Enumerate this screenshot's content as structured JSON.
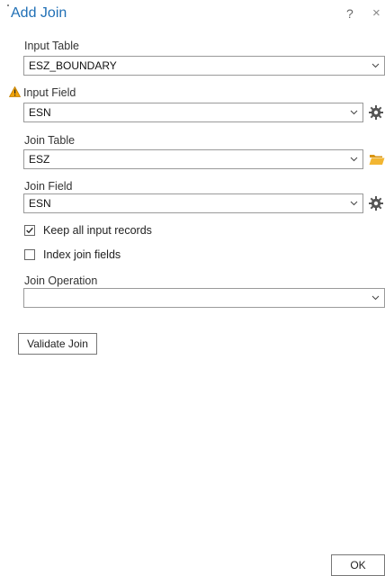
{
  "dialog": {
    "title": "Add Join",
    "help": "?",
    "close": "×"
  },
  "fields": {
    "input_table": {
      "label": "Input Table",
      "value": "ESZ_BOUNDARY"
    },
    "input_field": {
      "label": "Input Field",
      "value": "ESN",
      "warning": true
    },
    "join_table": {
      "label": "Join Table",
      "value": "ESZ"
    },
    "join_field": {
      "label": "Join Field",
      "value": "ESN"
    },
    "join_operation": {
      "label": "Join Operation",
      "value": ""
    }
  },
  "options": {
    "keep_all_records": {
      "label": "Keep all input records",
      "checked": true
    },
    "index_join_fields": {
      "label": "Index join fields",
      "checked": false
    }
  },
  "buttons": {
    "validate": "Validate Join",
    "ok": "OK"
  },
  "colors": {
    "title": "#1f6fb5",
    "warning": "#f0a30a",
    "folder": "#e8a317"
  },
  "icons": {
    "warning": "warning-triangle-icon",
    "gear": "gear-icon",
    "folder": "folder-open-icon",
    "chevron": "chevron-down-icon"
  }
}
